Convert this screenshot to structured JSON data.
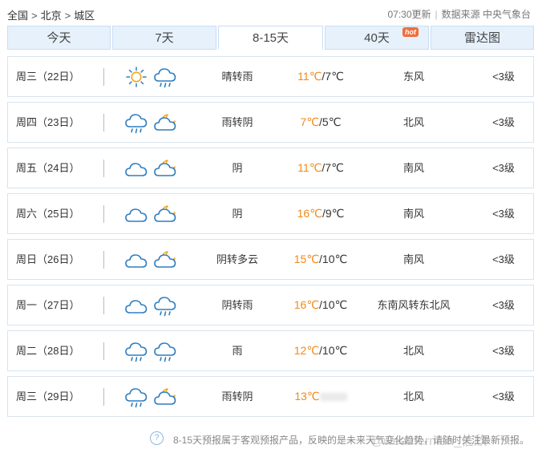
{
  "breadcrumb": {
    "items": [
      "全国",
      "北京",
      "城区"
    ],
    "separator": ">"
  },
  "update": {
    "time": "07:30更新",
    "source": "数据来源 中央气象台"
  },
  "tabs": [
    {
      "label": "今天"
    },
    {
      "label": "7天"
    },
    {
      "label": "8-15天",
      "active": true
    },
    {
      "label": "40天",
      "badge": "hot"
    },
    {
      "label": "雷达图"
    }
  ],
  "colors": {
    "accent_temp": "#f08a1c",
    "tab_bg": "#e6f1fb",
    "icon": "#2f7ec0",
    "sun": "#f3a81c"
  },
  "forecast": [
    {
      "day": "周三（22日）",
      "icons": [
        "sun-icon",
        "cloud-rain-icon"
      ],
      "condition": "晴转雨",
      "high": "11℃",
      "low": "/7℃",
      "wind": "东风",
      "level": "<3级"
    },
    {
      "day": "周四（23日）",
      "icons": [
        "cloud-rain-icon",
        "moon-cloud-icon"
      ],
      "condition": "雨转阴",
      "high": "7℃",
      "low": "/5℃",
      "wind": "北风",
      "level": "<3级"
    },
    {
      "day": "周五（24日）",
      "icons": [
        "cloud-icon",
        "moon-cloud-icon"
      ],
      "condition": "阴",
      "high": "11℃",
      "low": "/7℃",
      "wind": "南风",
      "level": "<3级"
    },
    {
      "day": "周六（25日）",
      "icons": [
        "cloud-icon",
        "moon-cloud-icon"
      ],
      "condition": "阴",
      "high": "16℃",
      "low": "/9℃",
      "wind": "南风",
      "level": "<3级"
    },
    {
      "day": "周日（26日）",
      "icons": [
        "cloud-icon",
        "moon-cloud-icon"
      ],
      "condition": "阴转多云",
      "high": "15℃",
      "low": "/10℃",
      "wind": "南风",
      "level": "<3级"
    },
    {
      "day": "周一（27日）",
      "icons": [
        "cloud-icon",
        "cloud-rain-icon"
      ],
      "condition": "阴转雨",
      "high": "16℃",
      "low": "/10℃",
      "wind": "东南风转东北风",
      "level": "<3级"
    },
    {
      "day": "周二（28日）",
      "icons": [
        "cloud-rain-icon",
        "cloud-rain-icon"
      ],
      "condition": "雨",
      "high": "12℃",
      "low": "/10℃",
      "wind": "北风",
      "level": "<3级"
    },
    {
      "day": "周三（29日）",
      "icons": [
        "cloud-rain-icon",
        "moon-cloud-icon"
      ],
      "condition": "雨转阴",
      "high": "13℃",
      "low": "",
      "wind": "北风",
      "level": "<3级"
    }
  ],
  "footer": {
    "note": "8-15天预报属于客观预报产品，反映的是未来天气变化趋势，请随时关注最新预报。",
    "watermark": "@weatherman_信欣"
  }
}
